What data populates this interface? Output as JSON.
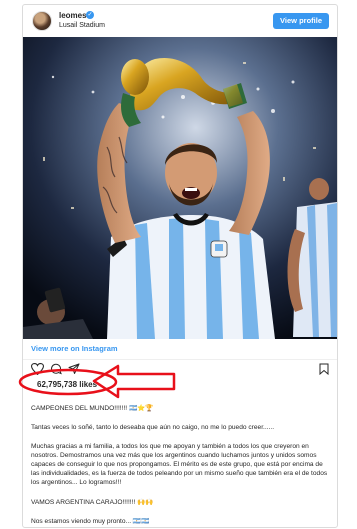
{
  "post": {
    "username": "leomessi",
    "location": "Lusail Stadium",
    "view_profile_label": "View profile",
    "view_more_label": "View more on Instagram",
    "likes": "62,795,738 likes"
  },
  "caption": {
    "line1": "CAMPEONES DEL MUNDO!!!!!!! 🇦🇷⭐🏆",
    "line2": "Tantas veces lo soñé, tanto lo deseaba que aún no caigo, no me lo puedo creer......",
    "line3": "Muchas gracias a mi familia, a todos los que me apoyan y también a todos los que creyeron en nosotros. Demostramos una vez más que los argentinos cuando luchamos juntos y unidos somos capaces de conseguir lo que nos propongamos. El mérito es de este grupo, que está por encima de las individualidades, es la fuerza de todos peleando por un mismo sueño que también era el de todos los argentinos... Lo logramos!!!",
    "line4": "VAMOS ARGENTINA CARAJO!!!!!!! 🙌🙌",
    "line5": "Nos estamos viendo muy pronto... 🇦🇷🇦🇷"
  },
  "icons": [
    "verified-badge-icon",
    "heart-icon",
    "comment-icon",
    "share-icon",
    "bookmark-icon",
    "red-arrow-annotation"
  ],
  "colors": {
    "accent": "#3897f0",
    "annotation": "#e8101a",
    "text": "#262626"
  }
}
